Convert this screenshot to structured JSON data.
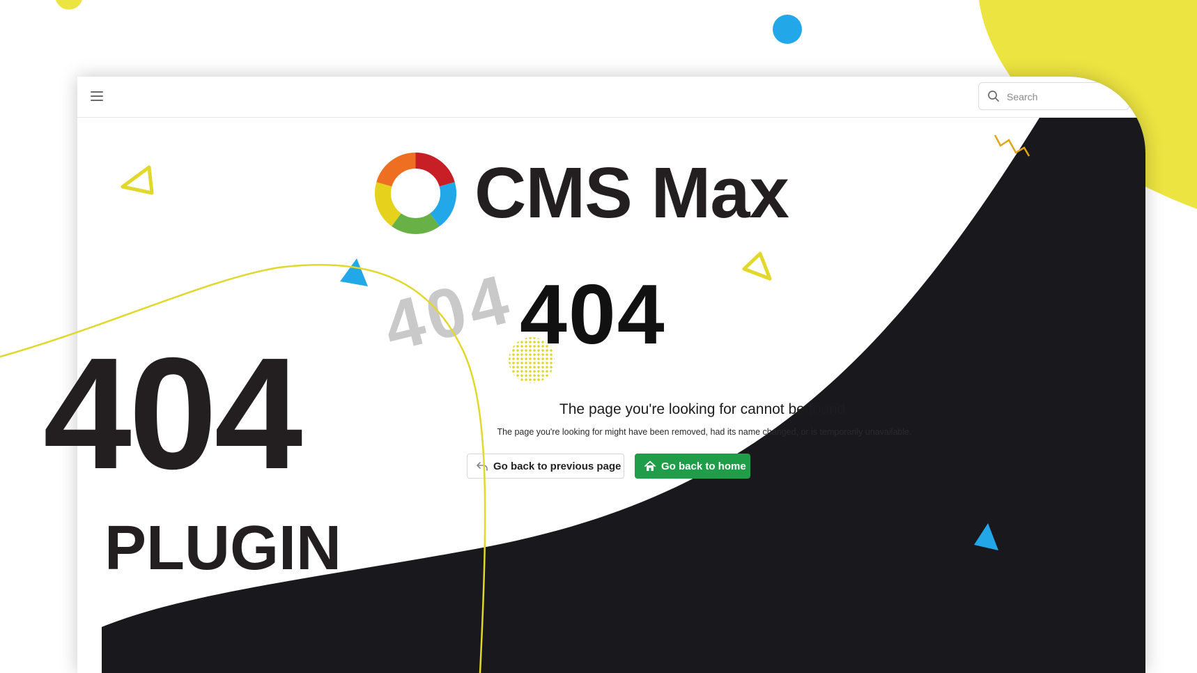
{
  "header": {
    "search_placeholder": "Search"
  },
  "brand": {
    "name": "CMS Max"
  },
  "error": {
    "ghost_code": "404",
    "code": "404",
    "headline": "The page you're looking for cannot be found.",
    "description": "The page you're looking for might have been removed, had its name changed, or is temporarily unavailable."
  },
  "actions": {
    "back_label": "Go back to previous page",
    "home_label": "Go back to home"
  },
  "overlay": {
    "big_code": "404",
    "plugin_label": "PLUGIN"
  },
  "icons": [
    "menu-icon",
    "search-icon",
    "back-arrow-icon",
    "home-icon",
    "cms-max-logo"
  ],
  "colors": {
    "accent_yellow": "#ece441",
    "accent_blue": "#22a7e8",
    "dark": "#19181c",
    "button_green": "#1f9d49",
    "text_dark": "#231f20"
  }
}
